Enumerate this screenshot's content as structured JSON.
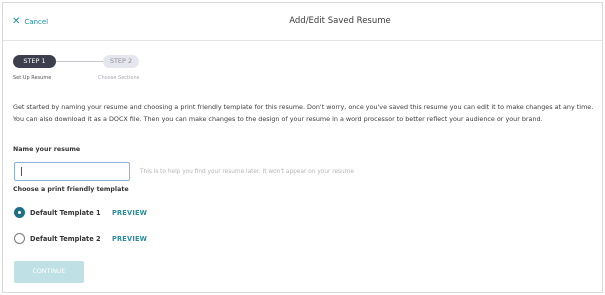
{
  "header": {
    "cancel_label": "Cancel",
    "title": "Add/Edit Saved Resume"
  },
  "stepper": {
    "steps": [
      {
        "label": "STEP 1",
        "subtitle": "Set Up Resume",
        "active": true
      },
      {
        "label": "STEP 2",
        "subtitle": "Choose Sections",
        "active": false
      }
    ]
  },
  "intro_text": "Get started by naming your resume and choosing a print friendly template for this resume. Don't worry, once you've saved this resume you can edit it to make changes at any time. You can also download it as a DOCX file. Then you can make changes to the design of your resume in a word processor to better reflect your audience or your brand.",
  "name_field": {
    "label": "Name your resume",
    "value": "",
    "hint": "This is to help you find your resume later. It won't appear on your resume"
  },
  "template_section": {
    "label": "Choose a print friendly template",
    "options": [
      {
        "name": "Default Template 1",
        "preview_label": "PREVIEW",
        "selected": true
      },
      {
        "name": "Default Template 2",
        "preview_label": "PREVIEW",
        "selected": false
      }
    ]
  },
  "continue_label": "CONTINUE",
  "colors": {
    "accent": "#2b8c9c",
    "step_active": "#3d3f4d",
    "continue_disabled": "#bfe0e4"
  }
}
